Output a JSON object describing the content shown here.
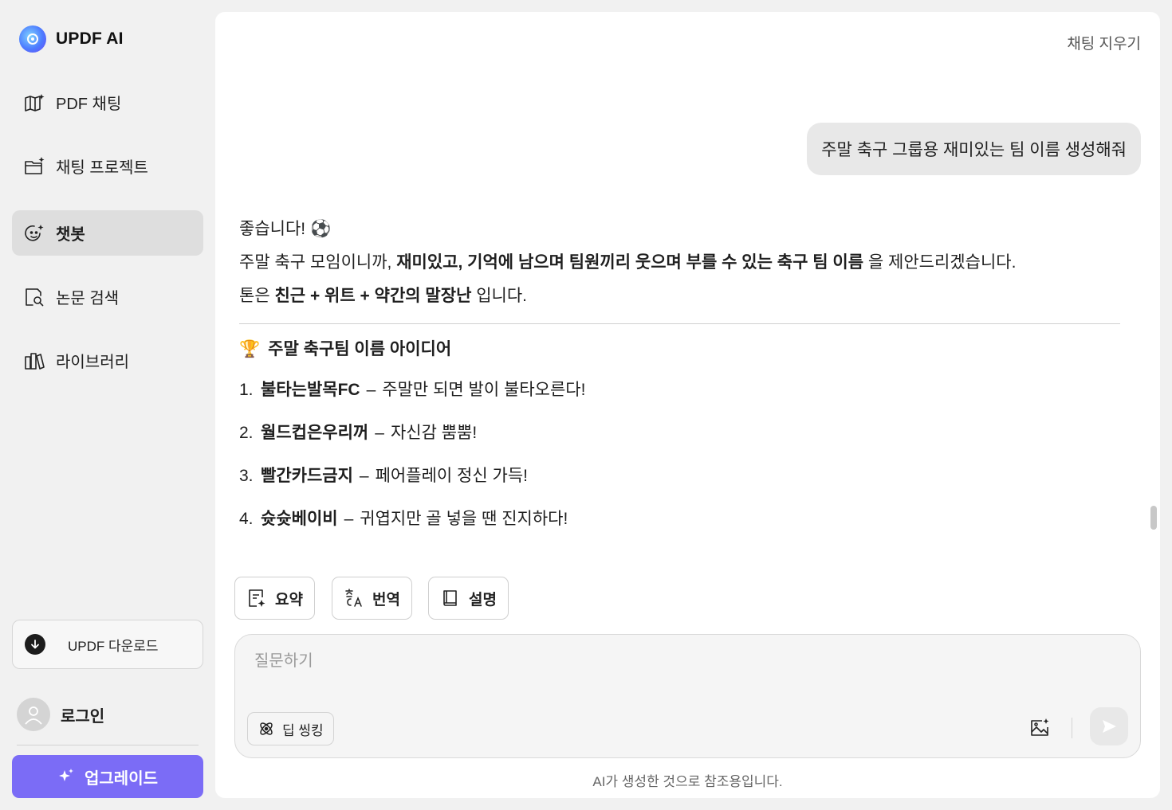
{
  "brand": {
    "name": "UPDF AI"
  },
  "nav": [
    {
      "label": "PDF 채팅",
      "icon": "book-sparkle-icon"
    },
    {
      "label": "채팅 프로젝트",
      "icon": "folder-sparkle-icon"
    },
    {
      "label": "챗봇",
      "icon": "chatbot-icon",
      "active": true
    },
    {
      "label": "논문 검색",
      "icon": "paper-search-icon"
    },
    {
      "label": "라이브러리",
      "icon": "library-icon"
    }
  ],
  "sidebar": {
    "download_label": "UPDF 다운로드",
    "login_label": "로그인",
    "upgrade_label": "업그레이드"
  },
  "header": {
    "clear_chat": "채팅 지우기"
  },
  "chat": {
    "user_message": "주말 축구 그룹용 재미있는 팀 이름 생성해줘",
    "answer": {
      "greeting": "좋습니다! ⚽",
      "line2_prefix": "주말 축구 모임이니까, ",
      "line2_bold": "재미있고, 기억에 남으며 팀원끼리 웃으며 부를 수 있는 축구 팀 이름",
      "line2_suffix": " 을 제안드리겠습니다.",
      "line3_prefix": "톤은 ",
      "line3_bold": "친근 + 위트 + 약간의 말장난",
      "line3_suffix": " 입니다.",
      "heading_emoji": "🏆",
      "heading": "주말 축구팀 이름 아이디어",
      "items": [
        {
          "num": "1.",
          "name": "불타는발목FC",
          "desc": "주말만 되면 발이 불타오른다!"
        },
        {
          "num": "2.",
          "name": "월드컵은우리꺼",
          "desc": "자신감 뿜뿜!"
        },
        {
          "num": "3.",
          "name": "빨간카드금지",
          "desc": "페어플레이 정신 가득!"
        },
        {
          "num": "4.",
          "name": "슛슛베이비",
          "desc": "귀엽지만 골 넣을 땐 진지하다!"
        }
      ]
    }
  },
  "quick_actions": [
    {
      "label": "요약",
      "icon": "summary-icon"
    },
    {
      "label": "번역",
      "icon": "translate-icon"
    },
    {
      "label": "설명",
      "icon": "explain-book-icon"
    }
  ],
  "composer": {
    "placeholder": "질문하기",
    "deep_thinking_label": "딥 씽킹"
  },
  "footer": {
    "disclaimer": "AI가 생성한 것으로 참조용입니다."
  }
}
